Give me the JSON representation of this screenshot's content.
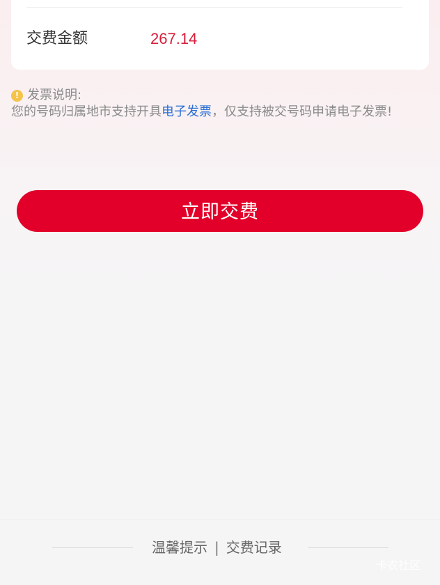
{
  "amount": {
    "label": "交费金额",
    "value": "267.14"
  },
  "notice": {
    "title": "发票说明:",
    "text_before_link": "您的号码归属地市支持开具",
    "link_text": "电子发票",
    "text_after_link": "，仅支持被交号码申请电子发票!"
  },
  "actions": {
    "pay_button": "立即交费"
  },
  "footer": {
    "tips": "温馨提示",
    "separator": "|",
    "records": "交费记录"
  },
  "watermark": "卡农社区",
  "colors": {
    "accent": "#e2002a",
    "amount": "#d81e3a",
    "link": "#2c6fd6",
    "warning": "#f5c34a"
  },
  "icons": {
    "notice": "exclamation-circle-icon"
  }
}
